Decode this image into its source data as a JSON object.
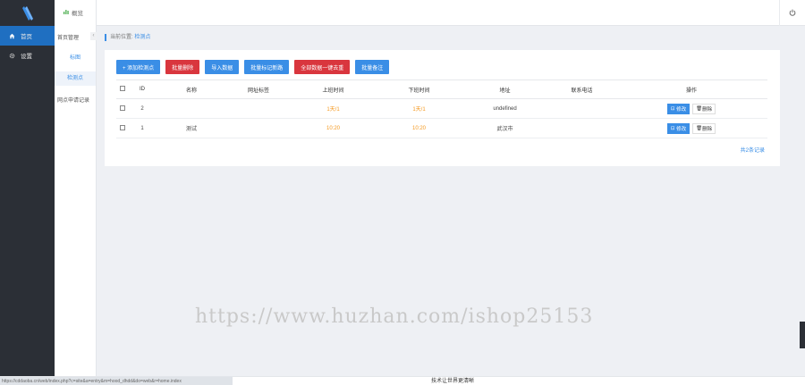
{
  "sidebar": {
    "items": [
      {
        "label": "首页",
        "icon": "home-icon",
        "active": true
      },
      {
        "label": "设置",
        "icon": "gear-icon",
        "active": false
      }
    ]
  },
  "subbar": {
    "top_label": "概览",
    "group_label": "首页管理",
    "collapse_glyph": "‹",
    "items": [
      {
        "label": "标图"
      },
      {
        "label": "检测点"
      },
      {
        "label": "网点申请记录"
      }
    ]
  },
  "breadcrumb": {
    "prefix": "当前位置:",
    "current": "检测点"
  },
  "toolbar": {
    "buttons": [
      {
        "label": "+ 添加检测点",
        "color": "#3a8ee6"
      },
      {
        "label": "批量删除",
        "color": "#d9363e"
      },
      {
        "label": "导入数据",
        "color": "#3a8ee6"
      },
      {
        "label": "批量标记新路",
        "color": "#3a8ee6"
      },
      {
        "label": "全部数据一键去重",
        "color": "#d9363e"
      },
      {
        "label": "批量备注",
        "color": "#3a8ee6"
      }
    ]
  },
  "table": {
    "headers": [
      "ID",
      "名称",
      "网址标签",
      "上班时间",
      "下班时间",
      "地址",
      "联系电话",
      "操作"
    ],
    "rows": [
      {
        "id": "2",
        "name": "",
        "tag": "",
        "start": "1天/1",
        "end": "1天/1",
        "address": "undefined",
        "phone": "",
        "edit": "修改",
        "delete": "删除"
      },
      {
        "id": "1",
        "name": "测试",
        "tag": "",
        "start": "10:20",
        "end": "10:20",
        "address": "武汉市",
        "phone": "",
        "edit": "修改",
        "delete": "删除"
      }
    ]
  },
  "total_text": "共2条记录",
  "watermark": "https://www.huzhan.com/ishop25153",
  "footer": {
    "status_url": "https://cddaoba.cn/web/index.php?c=site&a=entry&m=hood_dhdd&do=web&r=home.index",
    "copyright": "技术让世界更清晰"
  },
  "colors": {
    "accent": "#3a8ee6",
    "danger": "#d9363e",
    "time": "#f59a23",
    "sidebar_bg": "#2b2f36"
  }
}
